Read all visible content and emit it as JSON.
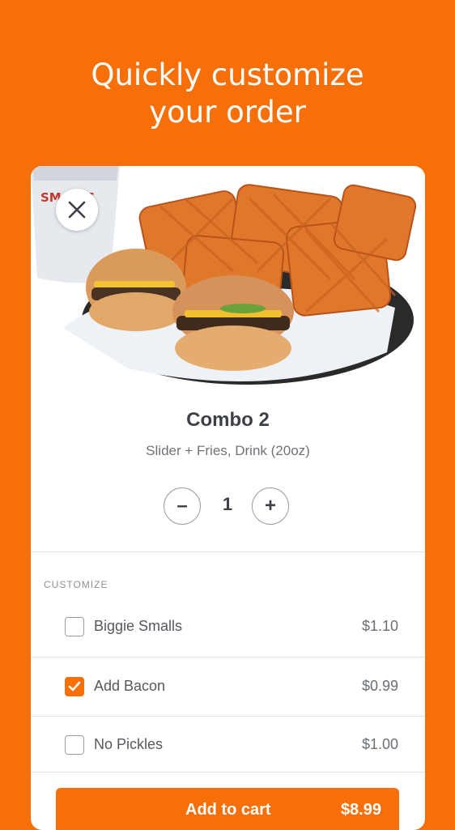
{
  "headline": {
    "line1": "Quickly customize",
    "line2": "your order"
  },
  "item": {
    "title": "Combo 2",
    "description": "Slider + Fries, Drink (20oz)",
    "quantity": "1",
    "minus_label": "–",
    "plus_label": "+",
    "image": "combo-photo-slider-fries-drink"
  },
  "customize": {
    "section_label": "CUSTOMIZE",
    "options": [
      {
        "name": "Biggie Smalls",
        "price": "$1.10",
        "checked": false
      },
      {
        "name": "Add Bacon",
        "price": "$0.99",
        "checked": true
      },
      {
        "name": "No Pickles",
        "price": "$1.00",
        "checked": false
      }
    ]
  },
  "cta": {
    "label": "Add to cart",
    "price": "$8.99"
  },
  "cup_print": "SMALLS",
  "colors": {
    "accent": "#f66f09",
    "text_dark": "#3d4147",
    "text_muted": "#6f7378"
  },
  "icons": {
    "close": "close-icon",
    "check": "check-icon"
  }
}
